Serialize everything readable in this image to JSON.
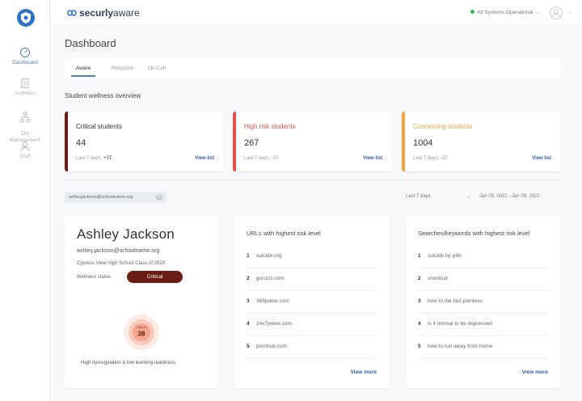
{
  "brand": {
    "name_bold": "securly",
    "name_light": "aware"
  },
  "nav": [
    {
      "label": "Dashboard",
      "icon": "gauge-icon",
      "active": true
    },
    {
      "label": "Activities",
      "icon": "document-icon",
      "active": false
    },
    {
      "label": "OU\nManagement",
      "icon": "org-tree-icon",
      "active": false
    },
    {
      "label": "Staff",
      "icon": "person-icon",
      "active": false
    }
  ],
  "topbar": {
    "status": "All Systems Operational",
    "status_color": "#38b36b"
  },
  "page": {
    "title": "Dashboard"
  },
  "tabs": [
    "Aware",
    "Respond",
    "On-Call"
  ],
  "overview": {
    "title": "Student wellness overview",
    "cards": [
      {
        "label": "Critical students",
        "value": "44",
        "sub_prefix": "Last 7 days:",
        "sub_value": "+37",
        "link": "View list",
        "color": "#6b1c14",
        "label_color": "#333"
      },
      {
        "label": "High risk students",
        "value": "267",
        "sub_prefix": "Last 7 days:",
        "sub_value": "-07",
        "link": "View list",
        "color": "#e0524a",
        "label_color": "#e0524a"
      },
      {
        "label": "Concerning students",
        "value": "1004",
        "sub_prefix": "Last 7 days:",
        "sub_value": "-07",
        "link": "View list",
        "color": "#f2a53a",
        "label_color": "#f2a53a"
      }
    ]
  },
  "filter": {
    "email_chip": "ashleyjackson@schoolname.org",
    "range": "Last 7 days",
    "dates": "Jan 03, 2022 - Jan 09, 2022"
  },
  "profile": {
    "name": "Ashley Jackson",
    "email": "ashley.jackson@schoolname.org",
    "school": "Cypress View High School Class of 2028",
    "wellness_label": "Wellness status",
    "wellness_value": "Critical",
    "score_label": "Risk ix",
    "score": "38",
    "caption": "High dysregulation & low learning readiness."
  },
  "urls": {
    "title": "URLs with highest risk level",
    "items": [
      "suicide.org",
      "gunzzz.com",
      "365poker.com",
      "24x7poker.com",
      "pornhub.com"
    ],
    "link": "View more"
  },
  "searches": {
    "title": "Searches/keywords with highest risk level",
    "items": [
      "suicide by pills",
      "shootout",
      "how to die fast painless",
      "is it normal to be depressed",
      "how to run away from home"
    ],
    "link": "View more"
  }
}
